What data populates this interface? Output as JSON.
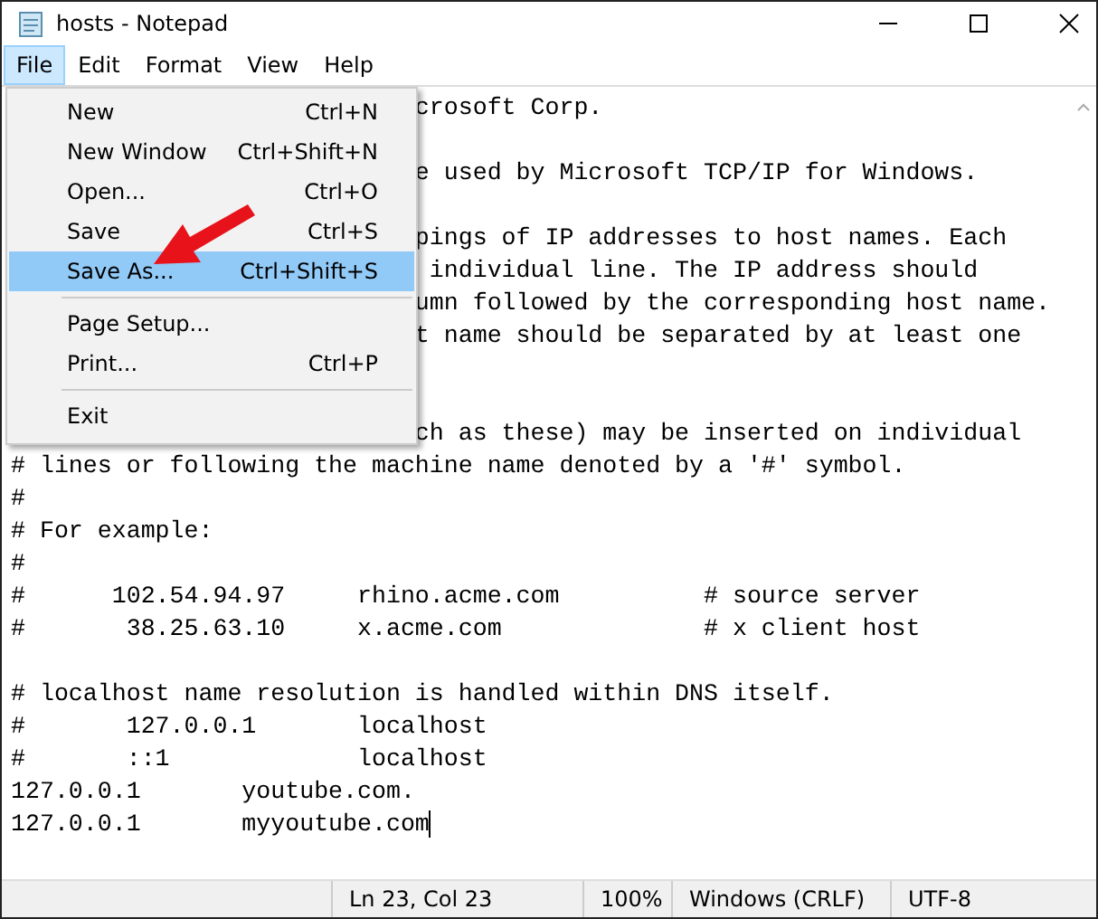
{
  "window": {
    "title": "hosts - Notepad"
  },
  "menubar": [
    {
      "label": "File",
      "selected": true
    },
    {
      "label": "Edit",
      "selected": false
    },
    {
      "label": "Format",
      "selected": false
    },
    {
      "label": "View",
      "selected": false
    },
    {
      "label": "Help",
      "selected": false
    }
  ],
  "file_menu": [
    {
      "kind": "item",
      "label": "New",
      "shortcut": "Ctrl+N",
      "selected": false
    },
    {
      "kind": "item",
      "label": "New Window",
      "shortcut": "Ctrl+Shift+N",
      "selected": false
    },
    {
      "kind": "item",
      "label": "Open...",
      "shortcut": "Ctrl+O",
      "selected": false
    },
    {
      "kind": "item",
      "label": "Save",
      "shortcut": "Ctrl+S",
      "selected": false
    },
    {
      "kind": "item",
      "label": "Save As...",
      "shortcut": "Ctrl+Shift+S",
      "selected": true
    },
    {
      "kind": "separator"
    },
    {
      "kind": "item",
      "label": "Page Setup...",
      "selected": false
    },
    {
      "kind": "item",
      "label": "Print...",
      "shortcut": "Ctrl+P",
      "selected": false
    },
    {
      "kind": "separator"
    },
    {
      "kind": "item",
      "label": "Exit",
      "selected": false
    }
  ],
  "editor": {
    "lines": [
      {
        "kind": "covered",
        "text": "crosoft Corp."
      },
      {
        "kind": "blank"
      },
      {
        "kind": "covered",
        "text": "e used by Microsoft TCP/IP for Windows."
      },
      {
        "kind": "blank"
      },
      {
        "kind": "covered",
        "text": "pings of IP addresses to host names. Each"
      },
      {
        "kind": "covered",
        "text": " individual line. The IP address should"
      },
      {
        "kind": "covered",
        "text": "umn followed by the corresponding host name."
      },
      {
        "kind": "covered",
        "text": "t name should be separated by at least one"
      },
      {
        "kind": "blank"
      },
      {
        "kind": "blank"
      },
      {
        "kind": "covered",
        "text": "ch as these) may be inserted on individual"
      },
      {
        "kind": "full",
        "text": "# lines or following the machine name denoted by a '#' symbol."
      },
      {
        "kind": "full",
        "text": "#"
      },
      {
        "kind": "full",
        "text": "# For example:"
      },
      {
        "kind": "full",
        "text": "#"
      },
      {
        "kind": "full",
        "text": "#      102.54.94.97     rhino.acme.com          # source server"
      },
      {
        "kind": "full",
        "text": "#       38.25.63.10     x.acme.com              # x client host"
      },
      {
        "kind": "blank"
      },
      {
        "kind": "full",
        "text": "# localhost name resolution is handled within DNS itself."
      },
      {
        "kind": "full",
        "text": "#       127.0.0.1       localhost"
      },
      {
        "kind": "full",
        "text": "#       ::1             localhost"
      },
      {
        "kind": "full",
        "text": "127.0.0.1       youtube.com."
      },
      {
        "kind": "full",
        "text": "127.0.0.1       myyoutube.com",
        "cursor": true
      }
    ]
  },
  "status_bar": [
    "Ln 23, Col 23",
    "100%",
    "Windows (CRLF)",
    "UTF-8"
  ]
}
